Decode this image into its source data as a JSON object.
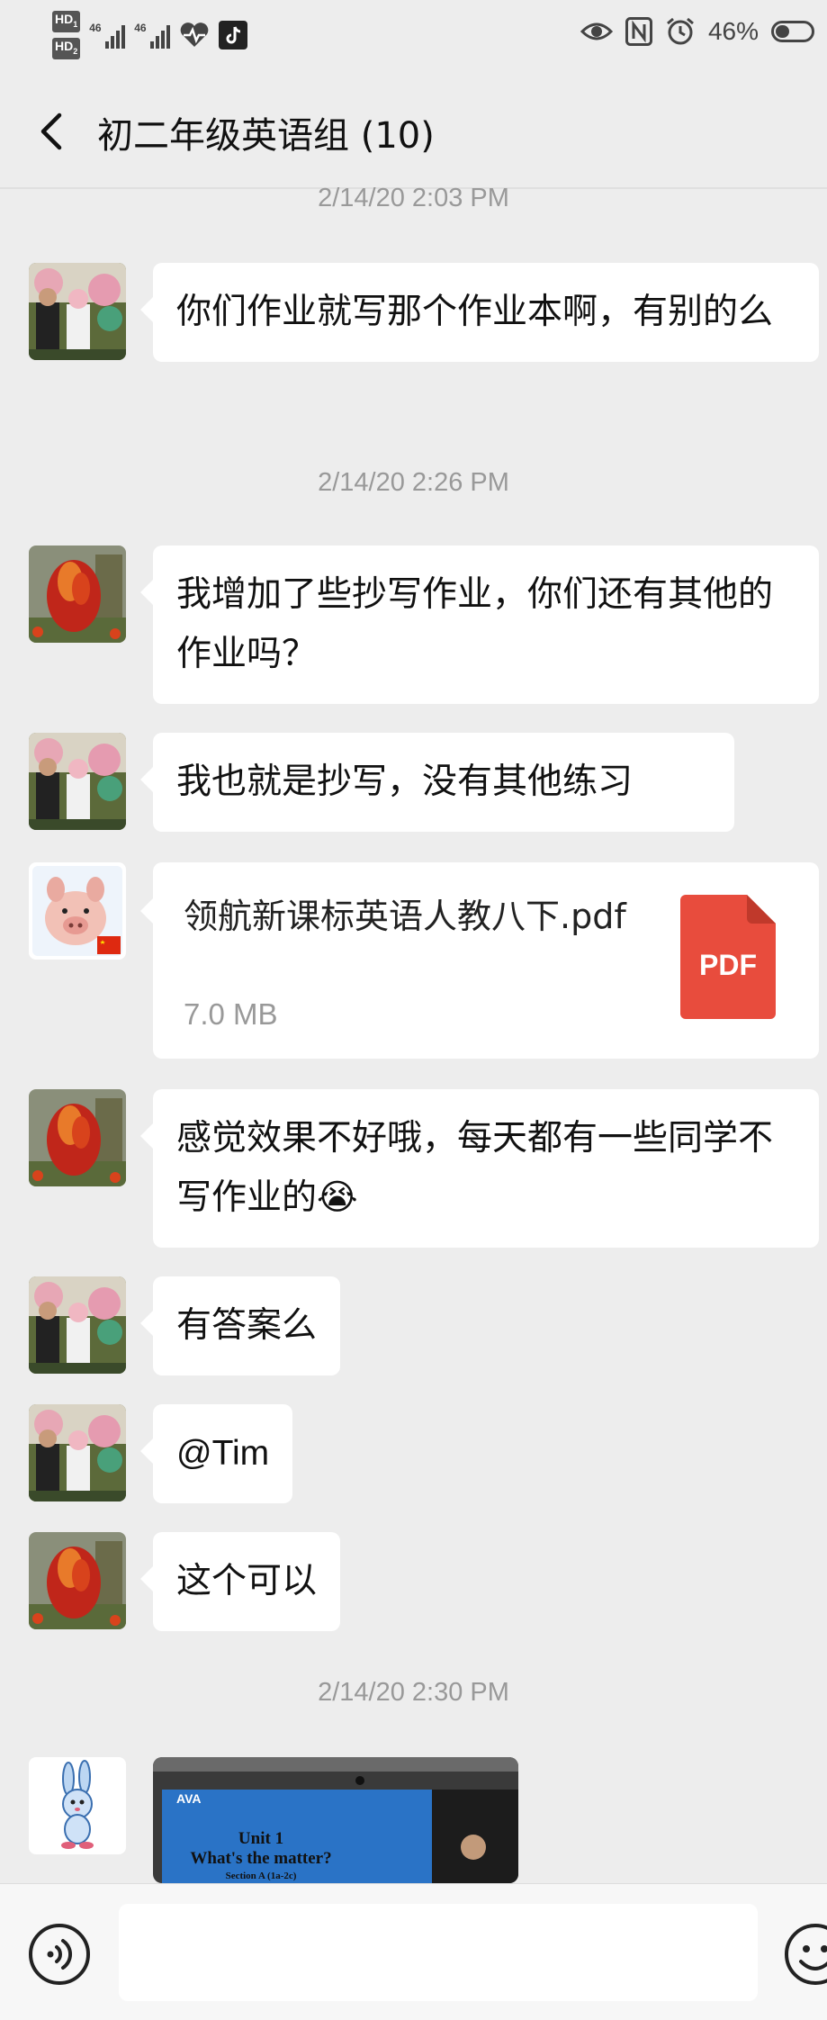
{
  "status_bar": {
    "hd1": "HD",
    "hd1_sub": "1",
    "hd2": "HD",
    "hd2_sub": "2",
    "signal1_label": "46",
    "signal2_label": "46",
    "battery_percent": "46%",
    "battery_level": 0.46,
    "icons": [
      "heartbeat-icon",
      "tiktok-icon",
      "eye-icon",
      "nfc-icon",
      "alarm-icon"
    ]
  },
  "header": {
    "title": "初二年级英语组 (10)"
  },
  "messages": {
    "ts1": "2/14/20 2:03 PM",
    "m1": "你们作业就写那个作业本啊，有别的么",
    "ts2": "2/14/20 2:26 PM",
    "m2": "我增加了些抄写作业，你们还有其他的作业吗？",
    "m3": "我也就是抄写，没有其他练习",
    "file": {
      "name": "领航新课标英语人教八下.pdf",
      "size": "7.0 MB",
      "icon_label": "PDF"
    },
    "m5": "感觉效果不好哦，每天都有一些同学不写作业的😭",
    "m6": "有答案么",
    "m7": "@Tim",
    "m8": "这个可以",
    "ts3": "2/14/20 2:30 PM",
    "image": {
      "brand": "AVA",
      "line1": "Unit 1",
      "line2": "What's the matter?",
      "line3": "Section A (1a-2c)"
    }
  },
  "colors": {
    "background": "#ededed",
    "bubble": "#ffffff",
    "pdf_red": "#e84c3d",
    "timestamp": "#999999"
  }
}
